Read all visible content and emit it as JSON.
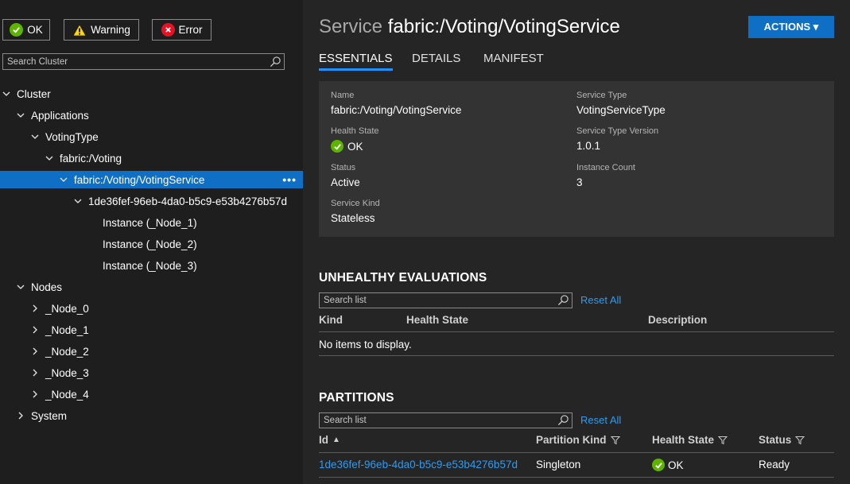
{
  "filters": {
    "ok_label": "OK",
    "warning_label": "Warning",
    "error_label": "Error"
  },
  "cluster_search": {
    "placeholder": "Search Cluster"
  },
  "tree": [
    {
      "label": "Cluster",
      "expanded": true
    },
    {
      "label": "Applications",
      "expanded": true
    },
    {
      "label": "VotingType",
      "expanded": true
    },
    {
      "label": "fabric:/Voting",
      "expanded": true
    },
    {
      "label": "fabric:/Voting/VotingService",
      "expanded": true,
      "selected": true,
      "more": "•••"
    },
    {
      "label": "1de36fef-96eb-4da0-b5c9-e53b4276b57d",
      "expanded": true
    },
    {
      "label": "Instance (_Node_1)"
    },
    {
      "label": "Instance (_Node_2)"
    },
    {
      "label": "Instance (_Node_3)"
    },
    {
      "label": "Nodes",
      "expanded": true
    },
    {
      "label": "_Node_0",
      "expanded": false
    },
    {
      "label": "_Node_1",
      "expanded": false
    },
    {
      "label": "_Node_2",
      "expanded": false
    },
    {
      "label": "_Node_3",
      "expanded": false
    },
    {
      "label": "_Node_4",
      "expanded": false
    },
    {
      "label": "System",
      "expanded": false
    }
  ],
  "header": {
    "kind": "Service",
    "name": "fabric:/Voting/VotingService",
    "actions_label": "ACTIONS ▾"
  },
  "tabs": [
    "ESSENTIALS",
    "DETAILS",
    "MANIFEST"
  ],
  "essentials": {
    "name_label": "Name",
    "name_value": "fabric:/Voting/VotingService",
    "health_label": "Health State",
    "health_value": "OK",
    "status_label": "Status",
    "status_value": "Active",
    "kind_label": "Service Kind",
    "kind_value": "Stateless",
    "type_label": "Service Type",
    "type_value": "VotingServiceType",
    "version_label": "Service Type Version",
    "version_value": "1.0.1",
    "count_label": "Instance Count",
    "count_value": "3"
  },
  "unhealthy": {
    "title": "UNHEALTHY EVALUATIONS",
    "search_placeholder": "Search list",
    "reset_label": "Reset All",
    "columns": [
      "Kind",
      "Health State",
      "Description"
    ],
    "empty_text": "No items to display."
  },
  "partitions": {
    "title": "PARTITIONS",
    "search_placeholder": "Search list",
    "reset_label": "Reset All",
    "columns": [
      "Id",
      "Partition Kind",
      "Health State",
      "Status"
    ],
    "sort_glyph": "▲",
    "rows": [
      {
        "id": "1de36fef-96eb-4da0-b5c9-e53b4276b57d",
        "kind": "Singleton",
        "health": "OK",
        "status": "Ready"
      }
    ]
  },
  "colors": {
    "accent": "#0e6fc4",
    "link": "#2e9bf0",
    "ok": "#5db300",
    "error": "#e81123",
    "warning": "#ffd800"
  }
}
